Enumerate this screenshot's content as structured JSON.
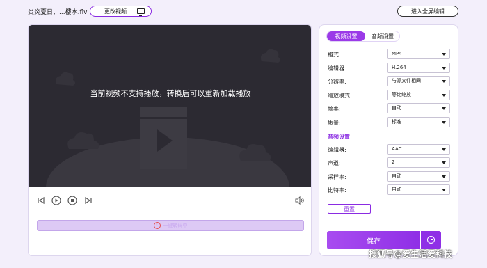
{
  "header": {
    "filename": "炎炎夏日，...樓水.flv",
    "change_video_label": "更改视频",
    "fullscreen_label": "进入全屏编辑"
  },
  "player": {
    "message": "当前视频不支持播放，转换后可以重新加载播放",
    "progress_text": "一键转码中"
  },
  "settings": {
    "tabs": [
      {
        "label": "视频设置",
        "active": true
      },
      {
        "label": "音频设置",
        "active": false
      }
    ],
    "video_rows": [
      {
        "label": "格式:",
        "value": "MP4"
      },
      {
        "label": "编辑器:",
        "value": "H.264"
      },
      {
        "label": "分辨率:",
        "value": "与源文件相同"
      },
      {
        "label": "缩放模式:",
        "value": "等比缩放"
      },
      {
        "label": "帧率:",
        "value": "自动"
      },
      {
        "label": "质量:",
        "value": "标准"
      }
    ],
    "audio_title": "音频设置",
    "audio_rows": [
      {
        "label": "编辑器:",
        "value": "AAC"
      },
      {
        "label": "声道:",
        "value": "2"
      },
      {
        "label": "采样率:",
        "value": "自动"
      },
      {
        "label": "比特率:",
        "value": "自动"
      }
    ],
    "reset_label": "重置",
    "save_label": "保存"
  },
  "watermark": "搜狐号@爱生活爱科技",
  "colors": {
    "accent": "#9b3ae8",
    "video_bg": "#2c2a32",
    "page_bg": "#f3effb"
  }
}
